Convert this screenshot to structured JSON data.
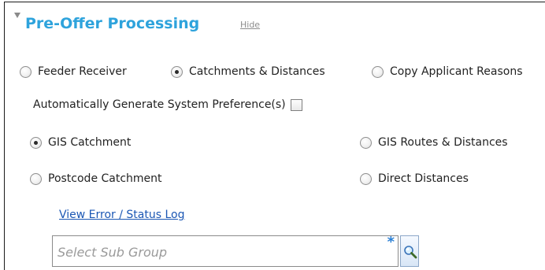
{
  "section": {
    "title": "Pre-Offer Processing",
    "hide_label": "Hide"
  },
  "process_options": [
    {
      "label": "Feeder Receiver",
      "selected": false
    },
    {
      "label": "Catchments & Distances",
      "selected": true
    },
    {
      "label": "Copy Applicant Reasons",
      "selected": false
    }
  ],
  "auto_generate": {
    "label": "Automatically Generate System Preference(s)",
    "checked": false
  },
  "catchment_options": [
    {
      "label": "GIS Catchment",
      "selected": true
    },
    {
      "label": "GIS Routes & Distances",
      "selected": false
    },
    {
      "label": "Postcode Catchment",
      "selected": false
    },
    {
      "label": "Direct Distances",
      "selected": false
    }
  ],
  "log_link": "View Error / Status Log",
  "sub_group": {
    "placeholder": "Select Sub Group",
    "value": "",
    "required_marker": "*"
  },
  "icons": {
    "collapse": "triangle-down-icon",
    "search": "magnifier-icon"
  },
  "colors": {
    "title": "#2ea3dc",
    "link": "#1b57b4",
    "hide_link": "#8d8d8d",
    "required": "#2a7fd4"
  }
}
